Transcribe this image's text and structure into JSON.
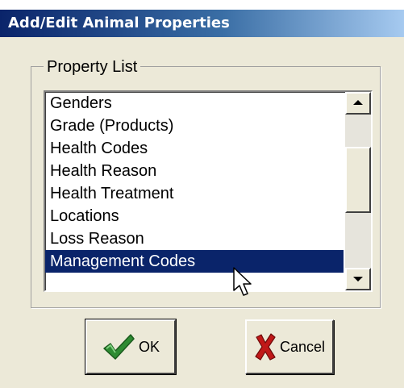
{
  "window": {
    "title": "Add/Edit Animal Properties"
  },
  "group": {
    "label": "Property List"
  },
  "list": {
    "items": [
      "Genders",
      "Grade (Products)",
      "Health Codes",
      "Health Reason",
      "Health Treatment",
      "Locations",
      "Loss Reason",
      "Management Codes"
    ],
    "selected_item": "Management Codes"
  },
  "buttons": {
    "ok_label": "OK",
    "ok_icon": "check-icon",
    "cancel_label": "Cancel",
    "cancel_icon": "x-icon"
  },
  "colors": {
    "selection": "#0a246a",
    "check": "#2e8b32",
    "cancel_x": "#c01818"
  }
}
